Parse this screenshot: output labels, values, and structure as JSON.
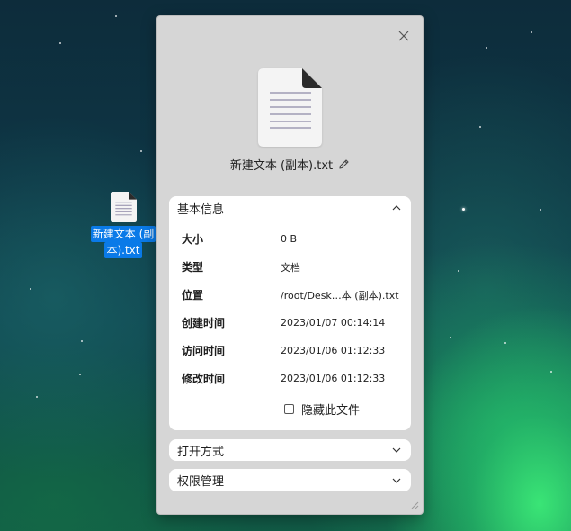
{
  "desktop": {
    "file": {
      "icon": "text-file-icon",
      "label_lines": [
        "新建文本 (副",
        "本).txt"
      ],
      "selected": true
    }
  },
  "dialog": {
    "close_icon": "close-icon",
    "file_icon": "text-document-icon",
    "file_name": "新建文本 (副本).txt",
    "edit_icon": "pencil-icon",
    "basic_info": {
      "title": "基本信息",
      "expanded": true,
      "rows": [
        {
          "label": "大小",
          "value": "0 B"
        },
        {
          "label": "类型",
          "value": "文档"
        },
        {
          "label": "位置",
          "value": "/root/Desk…本 (副本).txt"
        },
        {
          "label": "创建时间",
          "value": "2023/01/07 00:14:14"
        },
        {
          "label": "访问时间",
          "value": "2023/01/06 01:12:33"
        },
        {
          "label": "修改时间",
          "value": "2023/01/06 01:12:33"
        }
      ],
      "hide_file": {
        "label": "隐藏此文件",
        "checked": false
      }
    },
    "open_with": {
      "title": "打开方式",
      "expanded": false
    },
    "permissions": {
      "title": "权限管理",
      "expanded": false
    }
  },
  "colors": {
    "selection": "#0a7ae8",
    "dialog_bg": "#d6d6d6",
    "panel_bg": "#ffffff"
  }
}
